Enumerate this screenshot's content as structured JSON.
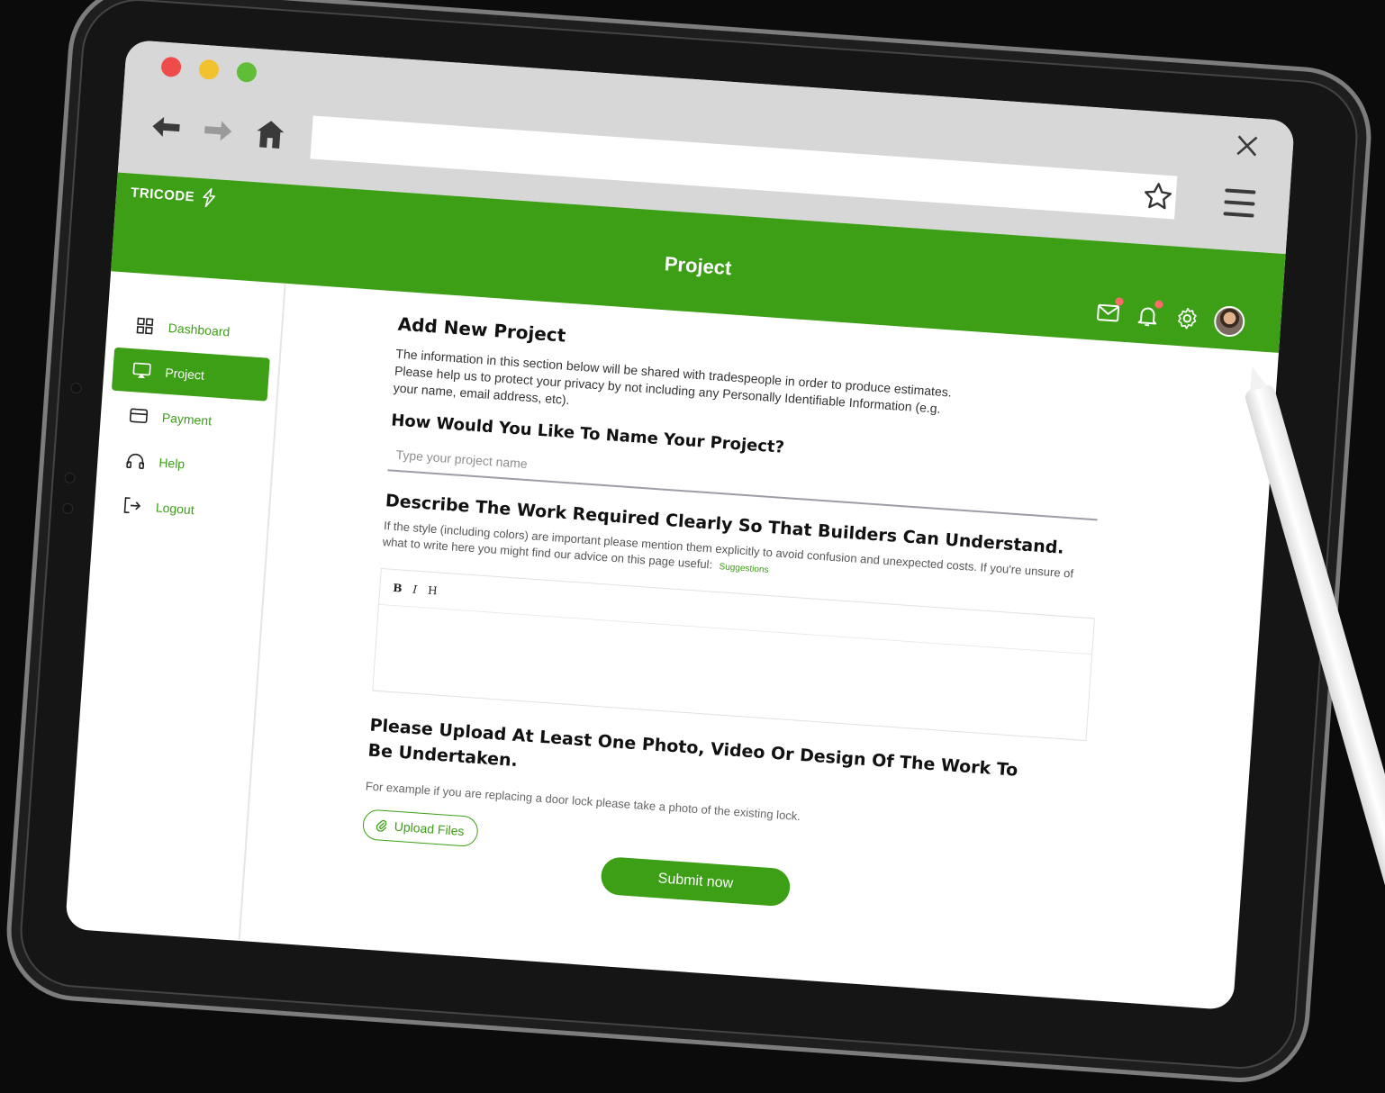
{
  "browser": {
    "address_value": "",
    "traffic_colors": [
      "#ee4b4b",
      "#f2c12e",
      "#5fbd37"
    ]
  },
  "header": {
    "logo_text": "TRICODE",
    "title": "Project",
    "accent": "#3c9f16"
  },
  "sidebar": {
    "items": [
      {
        "label": "Dashboard",
        "icon": "grid-icon",
        "active": false
      },
      {
        "label": "Project",
        "icon": "cast-icon",
        "active": true
      },
      {
        "label": "Payment",
        "icon": "card-icon",
        "active": false
      },
      {
        "label": "Help",
        "icon": "headphones-icon",
        "active": false
      },
      {
        "label": "Logout",
        "icon": "logout-icon",
        "active": false
      }
    ]
  },
  "form": {
    "heading": "Add New Project",
    "privacy_note": "The information in this section below will be shared with tradespeople in order to produce estimates. Please help us to protect your privacy by not including any Personally Identifiable Information (e.g. your name, email address, etc).",
    "name_question": "How Would You Like To Name Your Project?",
    "name_placeholder": "Type your project name",
    "name_value": "",
    "describe_question": "Describe The Work Required Clearly So That Builders Can Understand.",
    "describe_help": "If the style (including colors) are important please mention them explicitly to avoid confusion and unexpected costs. If you're unsure of what to write here you might find our advice on this page useful:",
    "suggestions_link": "Suggestions",
    "toolbar": {
      "bold": "B",
      "italic": "I",
      "heading": "H"
    },
    "description_value": "",
    "upload_question": "Please Upload At Least One Photo, Video Or Design Of The Work To Be Undertaken.",
    "upload_help": "For example if you are replacing a door lock please take a photo of the existing lock.",
    "upload_label": "Upload Files",
    "submit_label": "Submit now"
  }
}
